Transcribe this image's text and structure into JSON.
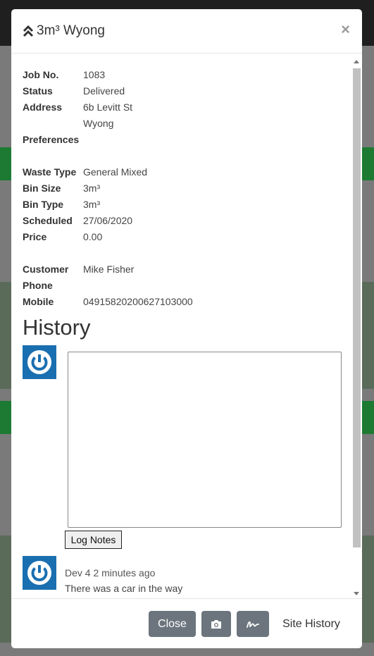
{
  "modal": {
    "title": "3m³ Wyong",
    "close_symbol": "×",
    "title_icon": "double-chevron-up-icon"
  },
  "details": {
    "job_no": {
      "label": "Job No.",
      "value": "1083"
    },
    "status": {
      "label": "Status",
      "value": "Delivered"
    },
    "address": {
      "label": "Address",
      "line1": "6b Levitt St",
      "line2": "Wyong"
    },
    "preferences": {
      "label": "Preferences",
      "value": ""
    },
    "waste_type": {
      "label": "Waste Type",
      "value": "General Mixed"
    },
    "bin_size": {
      "label": "Bin Size",
      "value": "3m³"
    },
    "bin_type": {
      "label": "Bin Type",
      "value": "3m³"
    },
    "scheduled": {
      "label": "Scheduled",
      "value": "27/06/2020"
    },
    "price": {
      "label": "Price",
      "value": "0.00"
    },
    "customer": {
      "label": "Customer",
      "value": "Mike Fisher"
    },
    "phone": {
      "label": "Phone",
      "value": ""
    },
    "mobile": {
      "label": "Mobile",
      "value": "04915820200627103000"
    }
  },
  "history": {
    "heading": "History",
    "notes_placeholder": "",
    "log_button": "Log Notes",
    "entries": [
      {
        "meta": "Dev 4 2 minutes ago",
        "text": "There was a car in the way"
      }
    ]
  },
  "footer": {
    "close_label": "Close",
    "camera_icon": "camera-icon",
    "signature_icon": "signature-icon",
    "site_history_label": "Site History"
  },
  "colors": {
    "link": "#2a73cc",
    "avatar": "#1a6fb0",
    "button_grey": "#6c757d",
    "background_green": "#1d7a33"
  }
}
